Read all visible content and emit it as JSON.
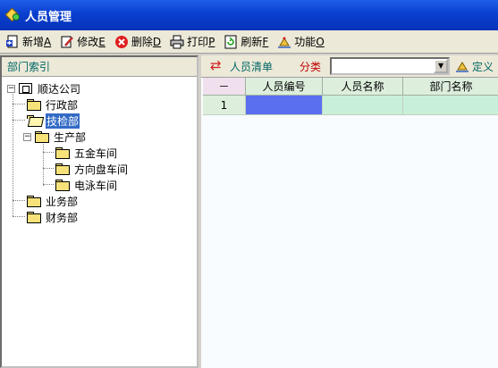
{
  "window": {
    "title": "人员管理"
  },
  "toolbar": {
    "buttons": [
      {
        "label": "新增",
        "key": "A"
      },
      {
        "label": "修改",
        "key": "E"
      },
      {
        "label": "删除",
        "key": "D"
      },
      {
        "label": "打印",
        "key": "P"
      },
      {
        "label": "刷新",
        "key": "F"
      },
      {
        "label": "功能",
        "key": "O"
      }
    ]
  },
  "sidebar": {
    "header": "部门索引",
    "tree": [
      {
        "label": "顺达公司"
      },
      {
        "label": "行政部"
      },
      {
        "label": "技检部",
        "selected": true
      },
      {
        "label": "生产部"
      },
      {
        "label": "五金车间"
      },
      {
        "label": "方向盘车间"
      },
      {
        "label": "电泳车间"
      },
      {
        "label": "业务部"
      },
      {
        "label": "财务部"
      }
    ]
  },
  "main": {
    "list_title": "人员清单",
    "category_label": "分类",
    "category_value": "",
    "define_label": "定义",
    "table": {
      "corner": "－",
      "columns": [
        "人员编号",
        "人员名称",
        "部门名称"
      ],
      "rows": [
        {
          "index": "1",
          "cells": [
            "",
            "",
            ""
          ]
        }
      ]
    }
  },
  "colors": {
    "title_bar": "#0a3fd0",
    "selection": "#316ac5",
    "active_cell": "#5a6ef0",
    "grid_header": "#ddeedd"
  }
}
